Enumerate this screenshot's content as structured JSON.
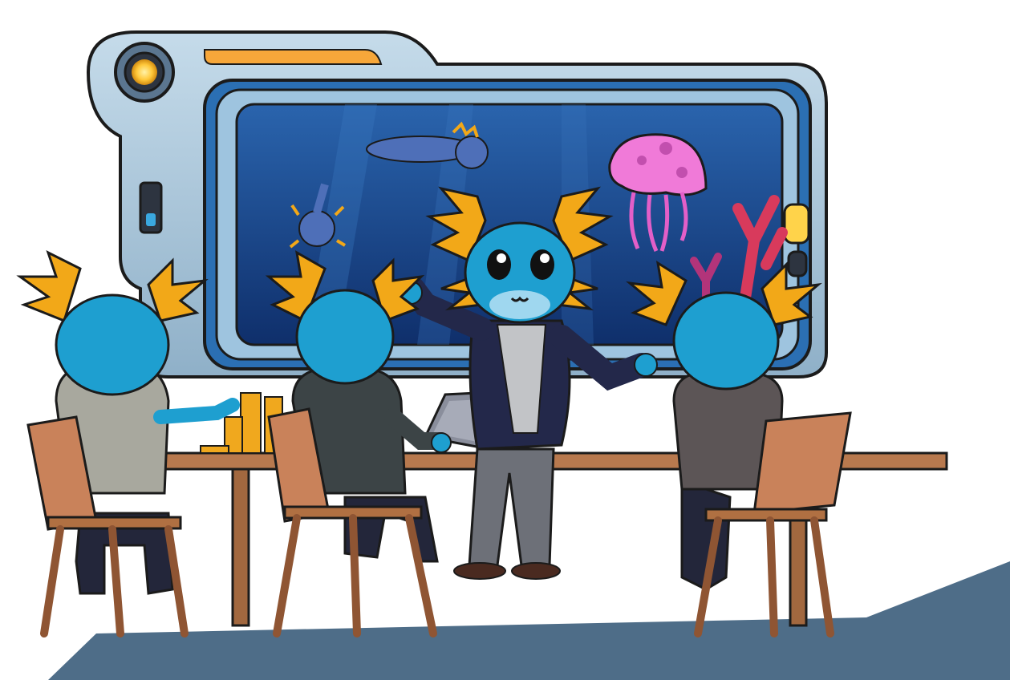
{
  "scene": {
    "background_color": "#ffffff",
    "floor_shadow_color": "#4e6d88",
    "description_hidden": true
  },
  "palette": {
    "monitor_frame": "#a9c6dc",
    "monitor_frame_dark": "#7d9bb4",
    "screen_water_top": "#1d4f93",
    "screen_water_bottom": "#0f2f6b",
    "axolotl_skin": "#1e9fd0",
    "axolotl_skin_light": "#3bb8ea",
    "gill_orange": "#f2a818",
    "gill_yellow": "#ffcf3a",
    "jellyfish_pink": "#f07ad8",
    "coral_red": "#d83a5c",
    "suit_navy": "#23284a",
    "shirt_gray": "#c2c4c7",
    "pants_gray": "#6d7078",
    "chair_wood": "#c9825a",
    "chair_wood_dark": "#8f5533",
    "table_wood": "#b8794e",
    "coin_gold": "#f0a81e",
    "tablet_gray": "#8a8e9c",
    "light_yellow": "#ffd34a"
  },
  "icons": {
    "power_light": "indicator-light-icon",
    "side_button": "toggle-switch-icon"
  }
}
